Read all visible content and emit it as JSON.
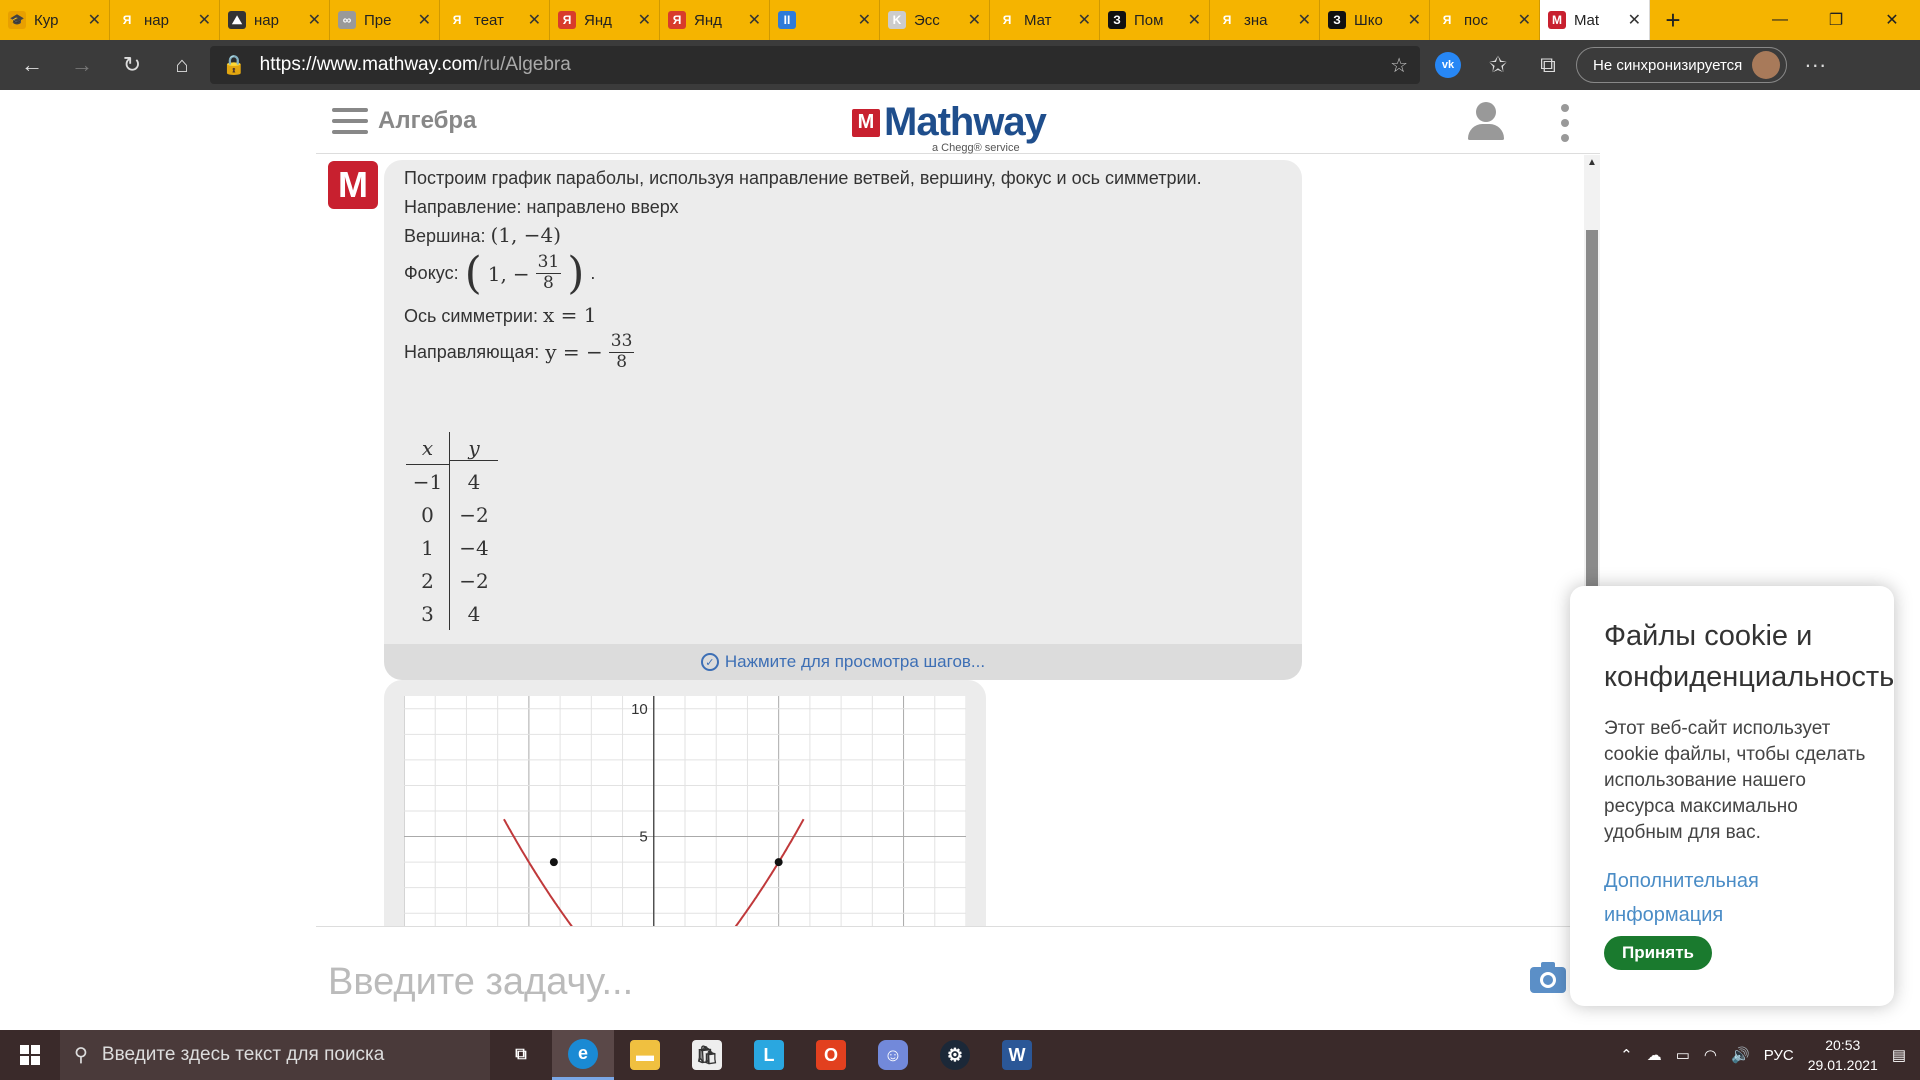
{
  "browser": {
    "tabs": [
      {
        "title": "Кур",
        "favicon_color": "#e8a000",
        "favicon_glyph": "🎓"
      },
      {
        "title": "нар",
        "favicon_color": "#f5b400",
        "favicon_glyph": "Я"
      },
      {
        "title": "нар",
        "favicon_color": "#333333",
        "favicon_glyph": "⛰"
      },
      {
        "title": "Пре",
        "favicon_color": "#999999",
        "favicon_glyph": "∞"
      },
      {
        "title": "теат",
        "favicon_color": "#f5b400",
        "favicon_glyph": "Я"
      },
      {
        "title": "Янд",
        "favicon_color": "#d83b2b",
        "favicon_glyph": "Я"
      },
      {
        "title": "Янд",
        "favicon_color": "#d83b2b",
        "favicon_glyph": "Я"
      },
      {
        "title": "",
        "favicon_color": "#2f7bd9",
        "favicon_glyph": "II"
      },
      {
        "title": "Эсс",
        "favicon_color": "#cccccc",
        "favicon_glyph": "K"
      },
      {
        "title": "Мат",
        "favicon_color": "#f5b400",
        "favicon_glyph": "Я"
      },
      {
        "title": "Пом",
        "favicon_color": "#111111",
        "favicon_glyph": "З"
      },
      {
        "title": "зна",
        "favicon_color": "#f5b400",
        "favicon_glyph": "Я"
      },
      {
        "title": "Шко",
        "favicon_color": "#111111",
        "favicon_glyph": "З"
      },
      {
        "title": "пос",
        "favicon_color": "#f5b400",
        "favicon_glyph": "Я"
      },
      {
        "title": "Mat",
        "favicon_color": "#c8202f",
        "favicon_glyph": "M",
        "active": true
      }
    ],
    "url_domain": "https://www.mathway.com",
    "url_path": "/ru/Algebra",
    "sync_label": "Не синхронизируется"
  },
  "site": {
    "section_title": "Алгебра",
    "logo_text": "Mathway",
    "logo_sub": "a Chegg® service"
  },
  "answer": {
    "intro": "Построим график параболы, используя направление ветвей, вершину, фокус и ось симметрии.",
    "direction_label": "Направление:",
    "direction_value": "направлено вверх",
    "vertex_label": "Вершина:",
    "vertex_value": "(1, −4)",
    "focus_label": "Фокус:",
    "focus_x": "1,",
    "focus_sign": "−",
    "focus_num": "31",
    "focus_den": "8",
    "axis_label": "Ось симметрии:",
    "axis_value": "x = 1",
    "directrix_label": "Направляющая:",
    "directrix_lhs": "y = −",
    "directrix_num": "33",
    "directrix_den": "8",
    "table_headers": [
      "x",
      "y"
    ],
    "table_rows": [
      [
        "−1",
        "4"
      ],
      [
        "0",
        "−2"
      ],
      [
        "1",
        "−4"
      ],
      [
        "2",
        "−2"
      ],
      [
        "3",
        "4"
      ]
    ],
    "steps_label": "Нажмите для просмотра шагов..."
  },
  "chart_data": {
    "type": "line",
    "title": "",
    "function": "y = 2x^2 - 4x - 2",
    "points": [
      {
        "x": -1,
        "y": 4
      },
      {
        "x": 3,
        "y": 4
      }
    ],
    "tick_labels": [
      "10",
      "5"
    ],
    "xlim": [
      -2,
      2.5
    ],
    "ylim": [
      1.5,
      10.5
    ],
    "grid": true,
    "curve_color": "#c0393b"
  },
  "input": {
    "placeholder": "Введите задачу..."
  },
  "cookie": {
    "title": "Файлы cookie и конфиденциальность",
    "body": "Этот веб-сайт использует cookie файлы, чтобы сделать использование нашего ресурса максимально удобным для вас.",
    "more_link": "Дополнительная информация",
    "accept": "Принять"
  },
  "taskbar": {
    "search_placeholder": "Введите здесь текст для поиска",
    "lang": "РУС",
    "time": "20:53",
    "date": "29.01.2021"
  }
}
